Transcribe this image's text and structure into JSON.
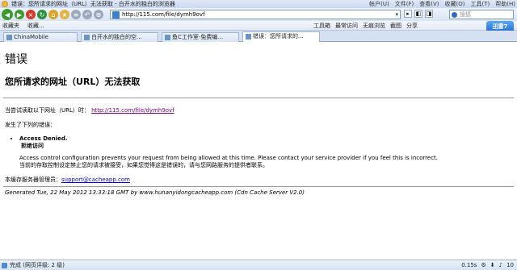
{
  "window": {
    "title": "错误：您所请求的网址（URL）无法获取 - 白开水的独白的浏览器",
    "menus": [
      "帐户(U)",
      "文件(F)",
      "查看(V)",
      "收藏(O)",
      "工具(T)",
      "帮助(H)"
    ]
  },
  "nav": {
    "address": "http://115.com/file/dymh9ovf",
    "search_placeholder": "搜狐"
  },
  "toolbar": {
    "favorites": "收藏夹",
    "bookmarks": "收藏...",
    "tools": "工具箱",
    "recent": "最常访问",
    "trace": "无痕浏览",
    "screenshot": "截图",
    "share": "分享",
    "xunlei": "迅雷7"
  },
  "tabs": [
    {
      "label": "ChinaMobile"
    },
    {
      "label": "白开水的独白的空..."
    },
    {
      "label": "鱼C工作室-免费编..."
    },
    {
      "label": "错误：您所请求的..."
    }
  ],
  "page": {
    "heading": "错误",
    "subheading": "您所请求的网址（URL）无法获取",
    "tried_prefix": "当尝试读取以下网址（URL）时：",
    "tried_url": "http://115.com/file/dymh9ovf",
    "error_intro": "发生了下列的错误：",
    "error_title": "Access Denied.",
    "error_title_cn": "拒绝访问",
    "detail_en": "Access control configuration prevents your request from being allowed at this time. Please contact your service provider if you feel this is incorrect.",
    "detail_cn": "当前的存取控制设定禁止您的请求被接受，如果您觉得这是错误的，请与您网路服务的提供者联系。",
    "admin_prefix": "本缓存服务器管理员：",
    "admin_email": "support@cacheapp.com",
    "generated": "Generated Tue, 22 May 2012 13:33:18 GMT by www.hunanyidongcacheapp.com (Cdn Cache Server V2.0)"
  },
  "status": {
    "text": "完成 (网页评级: 2 级)",
    "time": "0.15s",
    "zoom": "10"
  }
}
